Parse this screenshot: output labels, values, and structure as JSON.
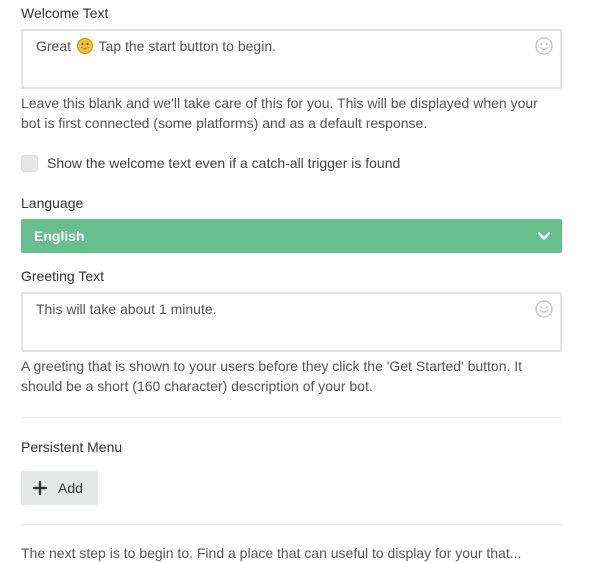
{
  "welcome": {
    "label": "Welcome Text",
    "value_prefix": "Great",
    "value_emoji": "grinning-face-emoji",
    "value_suffix": "Tap the start button to begin.",
    "help_line1": "Leave this blank and we'll take care of this for you. This will be displayed when your",
    "help_line2": "bot is first connected (some platforms) and as a default response.",
    "emoji_picker_icon": "smiley-icon"
  },
  "catch_all": {
    "checkbox_label": "Show the welcome text even if a catch-all trigger is found",
    "checked": false
  },
  "language": {
    "label": "Language",
    "selected": "English",
    "dropdown_icon": "chevron-down-icon"
  },
  "greeting": {
    "label": "Greeting Text",
    "value": "This will take about 1 minute.",
    "help_line1": "A greeting that is shown to your users before they click the 'Get Started' button. It",
    "help_line2": "should be a short (160 character) description of your bot.",
    "emoji_picker_icon": "smiley-icon"
  },
  "persistent_menu": {
    "label": "Persistent Menu",
    "add_label": "Add",
    "add_icon": "plus-icon"
  },
  "truncated_text": "The next step is to begin to. Find a place that can useful to display for your that..."
}
